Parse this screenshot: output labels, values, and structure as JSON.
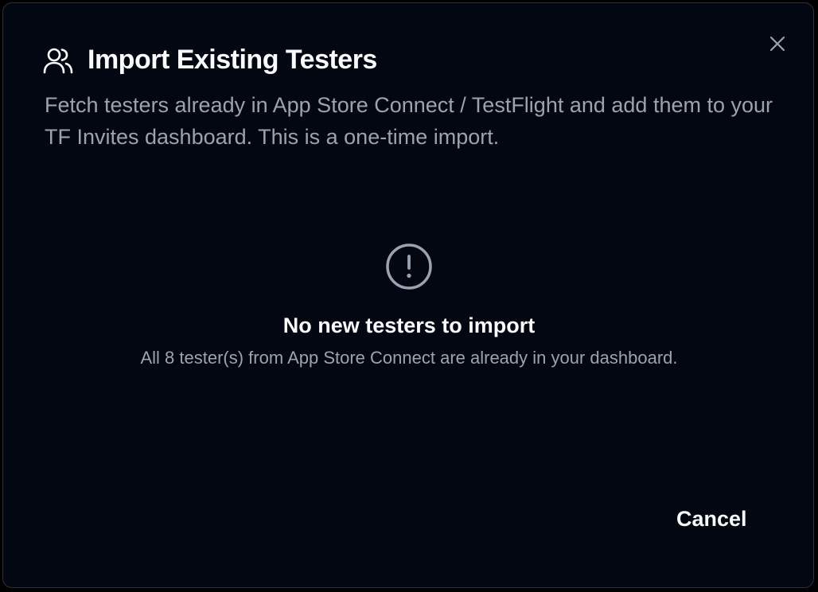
{
  "dialog": {
    "title": "Import Existing Testers",
    "title_icon": "users-icon",
    "close_icon": "close-icon",
    "description": "Fetch testers already in App Store Connect / TestFlight and add them to your TF Invites dashboard. This is a one-time import.",
    "empty_state": {
      "icon": "alert-circle-icon",
      "title": "No new testers to import",
      "subtitle": "All 8 tester(s) from App Store Connect are already in your dashboard."
    },
    "cancel_label": "Cancel"
  },
  "colors": {
    "background": "#030712",
    "text_primary": "#f9fafb",
    "text_muted": "#9ca3af",
    "icon_muted": "#9aa3b2"
  }
}
